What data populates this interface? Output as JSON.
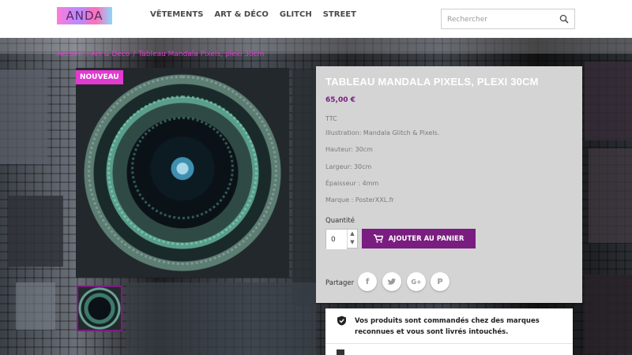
{
  "header": {
    "logo_text": "ANDA",
    "nav": [
      "VÊTEMENTS",
      "ART & DÉCO",
      "GLITCH",
      "STREET"
    ],
    "search_placeholder": "Rechercher"
  },
  "breadcrumb": [
    "Accueil",
    "Art & Déco",
    "Tableau Mandala Pixels, plexi 30cm"
  ],
  "product": {
    "badge": "NOUVEAU",
    "title": "TABLEAU MANDALA PIXELS, PLEXI 30CM",
    "price": "65,00 €",
    "tax": "TTC",
    "details": [
      "Illustration: Mandala Glitch & Pixels.",
      "Hauteur: 30cm",
      "Largeur: 30cm",
      "Épaisseur : 4mm",
      "Marque : PosterXXL.fr"
    ],
    "quantity_label": "Quantité",
    "quantity_value": "0",
    "add_to_cart": "AJOUTER AU PANIER",
    "share_label": "Partager",
    "share_networks": [
      "facebook-icon",
      "twitter-icon",
      "googleplus-icon",
      "pinterest-icon"
    ]
  },
  "reassurance": {
    "text": "Vos produits sont commandés chez des marques reconnues et vous sont livrés intouchés."
  },
  "colors": {
    "accent": "#7a1d80",
    "pink": "#e23bd0",
    "panel": "#d4d4d4"
  }
}
